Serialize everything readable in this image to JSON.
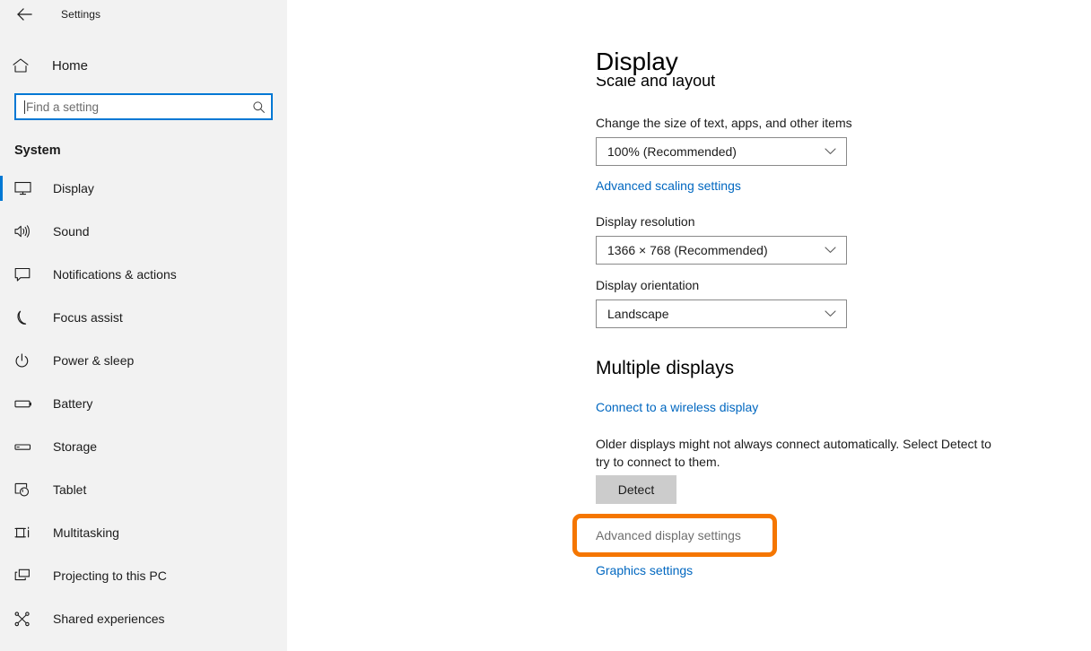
{
  "window": {
    "app_title": "Settings",
    "back_icon": "back-arrow-icon"
  },
  "sidebar": {
    "home": {
      "label": "Home",
      "icon": "home-icon"
    },
    "search": {
      "placeholder": "Find a setting",
      "value": "",
      "icon": "search-icon"
    },
    "section_title": "System",
    "selected": "Display",
    "accent_color": "#0078d4",
    "items": [
      {
        "label": "Display",
        "icon": "monitor-icon",
        "selected": true
      },
      {
        "label": "Sound",
        "icon": "speaker-icon",
        "selected": false
      },
      {
        "label": "Notifications & actions",
        "icon": "notification-balloon-icon",
        "selected": false
      },
      {
        "label": "Focus assist",
        "icon": "moon-icon",
        "selected": false
      },
      {
        "label": "Power & sleep",
        "icon": "power-icon",
        "selected": false
      },
      {
        "label": "Battery",
        "icon": "battery-icon",
        "selected": false
      },
      {
        "label": "Storage",
        "icon": "storage-drive-icon",
        "selected": false
      },
      {
        "label": "Tablet",
        "icon": "tablet-hand-icon",
        "selected": false
      },
      {
        "label": "Multitasking",
        "icon": "multitasking-icon",
        "selected": false
      },
      {
        "label": "Projecting to this PC",
        "icon": "projecting-icon",
        "selected": false
      },
      {
        "label": "Shared experiences",
        "icon": "share-nodes-icon",
        "selected": false
      }
    ]
  },
  "main": {
    "page_title": "Display",
    "scale_and_layout": {
      "heading": "Scale and layout",
      "scale_label": "Change the size of text, apps, and other items",
      "scale_value": "100% (Recommended)",
      "advanced_scaling_link": "Advanced scaling settings",
      "resolution_label": "Display resolution",
      "resolution_value": "1366 × 768 (Recommended)",
      "orientation_label": "Display orientation",
      "orientation_value": "Landscape"
    },
    "multiple_displays": {
      "heading": "Multiple displays",
      "wireless_link": "Connect to a wireless display",
      "detect_description": "Older displays might not always connect automatically. Select Detect to try to connect to them.",
      "detect_button": "Detect",
      "advanced_display_link": "Advanced display settings",
      "graphics_link": "Graphics settings"
    }
  },
  "annotation": {
    "target": "Advanced display settings",
    "color": "#f57600"
  }
}
